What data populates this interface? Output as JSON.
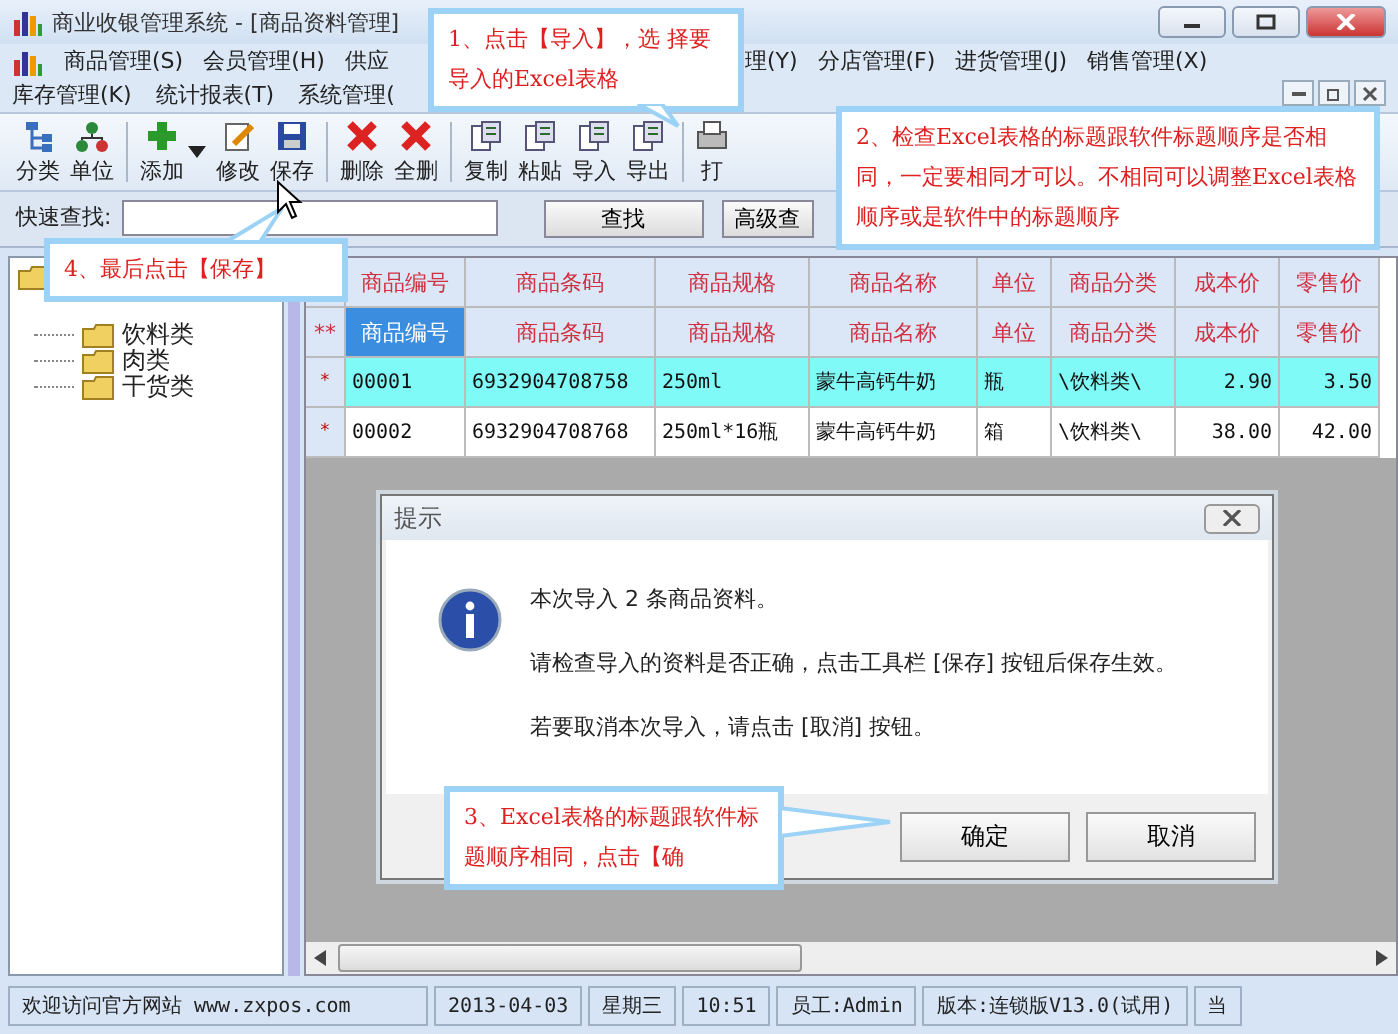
{
  "window": {
    "title": "商业收银管理系统 - [商品资料管理]"
  },
  "menu": [
    {
      "items": [
        "商品管理(S)",
        "会员管理(H)",
        "供应",
        "理(Y)",
        "分店管理(F)",
        "进货管理(J)",
        "销售管理(X)"
      ]
    },
    {
      "items": [
        "库存管理(K)",
        "统计报表(T)",
        "系统管理("
      ]
    }
  ],
  "toolbar": [
    {
      "items": [
        {
          "label": "分类",
          "dropdown": false
        },
        {
          "label": "单位",
          "dropdown": false
        }
      ]
    },
    {
      "items": [
        {
          "label": "添加",
          "dropdown": true
        },
        {
          "label": "修改",
          "dropdown": false
        },
        {
          "label": "保存",
          "dropdown": false
        }
      ]
    },
    {
      "items": [
        {
          "label": "删除",
          "dropdown": false
        },
        {
          "label": "全删",
          "dropdown": false
        }
      ]
    },
    {
      "items": [
        {
          "label": "复制",
          "dropdown": false
        },
        {
          "label": "粘贴",
          "dropdown": false
        },
        {
          "label": "导入",
          "dropdown": false
        },
        {
          "label": "导出",
          "dropdown": false
        }
      ]
    },
    {
      "items": [
        {
          "label": "打",
          "dropdown": false
        }
      ]
    }
  ],
  "search": {
    "label": "快速查找:",
    "buttons": [
      "查找",
      "高级查"
    ]
  },
  "tree": {
    "children": [
      {
        "label": "饮料类"
      },
      {
        "label": "肉类"
      },
      {
        "label": "干货类"
      }
    ]
  },
  "grid": {
    "columns": [
      "商品编号",
      "商品条码",
      "商品规格",
      "商品名称",
      "单位",
      "商品分类",
      "成本价",
      "零售价"
    ],
    "rows": [
      {
        "kind": "imported_header",
        "marker": "**",
        "selected": false,
        "focused": true,
        "cells": [
          "商品编号",
          "商品条码",
          "商品规格",
          "商品名称",
          "单位",
          "商品分类",
          "成本价",
          "零售价"
        ]
      },
      {
        "kind": "data",
        "marker": "*",
        "selected": true,
        "focused": false,
        "cells": [
          "00001",
          "6932904708758",
          "250ml",
          "蒙牛高钙牛奶",
          "瓶",
          "\\饮料类\\",
          "2.90",
          "3.50"
        ]
      },
      {
        "kind": "data",
        "marker": "*",
        "selected": false,
        "focused": false,
        "cells": [
          "00002",
          "6932904708768",
          "250ml*16瓶",
          "蒙牛高钙牛奶",
          "箱",
          "\\饮料类\\",
          "38.00",
          "42.00"
        ]
      }
    ]
  },
  "dialog": {
    "title": "提示",
    "lines": [
      "本次导入 2 条商品资料。",
      "请检查导入的资料是否正确，点击工具栏 [保存] 按钮后保存生效。",
      "若要取消本次导入，请点击 [取消] 按钮。"
    ],
    "buttons": [
      "确定",
      "取消"
    ]
  },
  "callouts": [
    "1、点击【导入】，选 择要导入的Excel表格",
    "2、检查Excel表格的标题跟软件标题顺序是否相同，一定要相同才可以。不相同可以调整Excel表格顺序或是软件中的标题顺序",
    "3、Excel表格的标题跟软件标题顺序相同，点击【确",
    "4、最后点击【保存】"
  ],
  "status_bar": [
    "欢迎访问官方网站 www.zxpos.com",
    "2013-04-03",
    "星期三",
    "10:51",
    "员工:Admin",
    "版本:连锁版V13.0(试用)",
    "当"
  ]
}
